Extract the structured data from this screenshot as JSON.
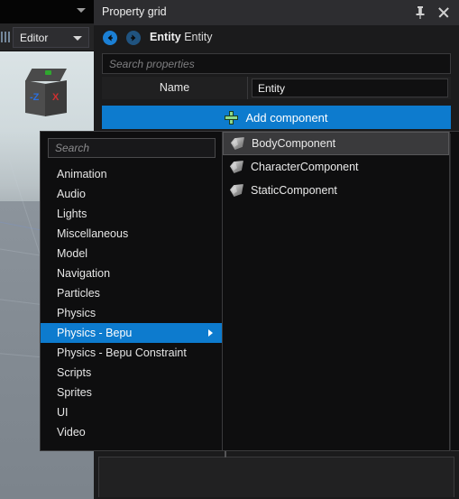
{
  "viewport": {
    "gizmo": {
      "axis_z_label": "-Z",
      "axis_x_label": "X"
    }
  },
  "topbar": {
    "editor_dropdown_label": "Editor"
  },
  "property_grid": {
    "title": "Property grid",
    "entity_label_bold": "Entity",
    "entity_label_name": " Entity",
    "search_placeholder": "Search properties",
    "name_row": {
      "label": "Name",
      "value": "Entity"
    },
    "add_component_label": "Add component",
    "accent_color": "#0d7bce",
    "plus_color": "#8cd98c"
  },
  "add_component_menu": {
    "search_placeholder": "Search",
    "categories": [
      {
        "label": "Animation",
        "selected": false,
        "has_submenu": false
      },
      {
        "label": "Audio",
        "selected": false,
        "has_submenu": false
      },
      {
        "label": "Lights",
        "selected": false,
        "has_submenu": false
      },
      {
        "label": "Miscellaneous",
        "selected": false,
        "has_submenu": false
      },
      {
        "label": "Model",
        "selected": false,
        "has_submenu": false
      },
      {
        "label": "Navigation",
        "selected": false,
        "has_submenu": false
      },
      {
        "label": "Particles",
        "selected": false,
        "has_submenu": false
      },
      {
        "label": "Physics",
        "selected": false,
        "has_submenu": false
      },
      {
        "label": "Physics - Bepu",
        "selected": true,
        "has_submenu": true
      },
      {
        "label": "Physics - Bepu Constraint",
        "selected": false,
        "has_submenu": false
      },
      {
        "label": "Scripts",
        "selected": false,
        "has_submenu": false
      },
      {
        "label": "Sprites",
        "selected": false,
        "has_submenu": false
      },
      {
        "label": "UI",
        "selected": false,
        "has_submenu": false
      },
      {
        "label": "Video",
        "selected": false,
        "has_submenu": false
      }
    ],
    "components": [
      {
        "label": "BodyComponent",
        "hovered": true
      },
      {
        "label": "CharacterComponent",
        "hovered": false
      },
      {
        "label": "StaticComponent",
        "hovered": false
      }
    ]
  }
}
